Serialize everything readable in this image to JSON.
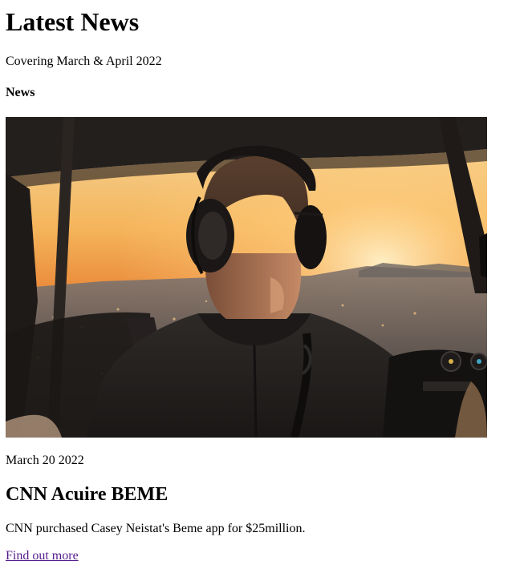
{
  "page": {
    "title": "Latest News",
    "subtitle": "Covering March & April 2022",
    "section_label": "News"
  },
  "article": {
    "image_alt": "Pilot wearing headphones in a helicopter cockpit at sunset over a city",
    "date": "March 20 2022",
    "headline": "CNN Acuire BEME",
    "summary": "CNN purchased Casey Neistat's Beme app for $25million.",
    "link_label": "Find out more"
  },
  "colors": {
    "link_visited": "#551a8b",
    "text": "#000000",
    "background": "#ffffff"
  }
}
